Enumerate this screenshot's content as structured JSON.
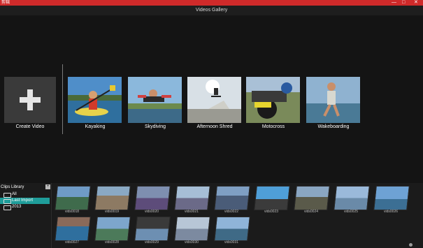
{
  "titlebar": {
    "app_name": "剪辑",
    "minimize": "—",
    "maximize": "□",
    "close": "✕",
    "color": "#cf2a2a"
  },
  "header": {
    "title": "Videos Gallery"
  },
  "create": {
    "label": "Create Video",
    "icon": "plus-icon"
  },
  "gallery": [
    {
      "label": "Kayaking"
    },
    {
      "label": "Skydiving"
    },
    {
      "label": "Afternoon Shred"
    },
    {
      "label": "Motocross"
    },
    {
      "label": "Wakeboarding"
    }
  ],
  "library": {
    "title": "Clips Library",
    "button": "+",
    "items": [
      {
        "label": "All",
        "active": false
      },
      {
        "label": "Last Import",
        "active": true
      },
      {
        "label": "2013",
        "active": false
      }
    ],
    "accent": "#1f9d9a"
  },
  "clips": [
    "vids0018",
    "vids0019",
    "vids0020",
    "vids0021",
    "vids0022",
    "vids0023",
    "vids0024",
    "vids0025",
    "vids0026",
    "vids0027",
    "vids0028",
    "vids0029",
    "vids0030",
    "vids0031"
  ],
  "watermark": "最需教育"
}
